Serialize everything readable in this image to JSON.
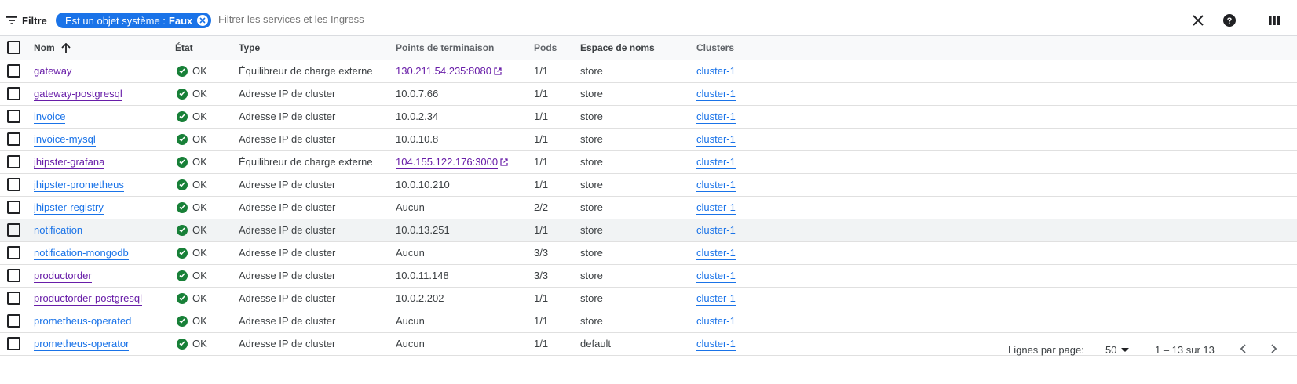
{
  "filter": {
    "label": "Filtre",
    "chip_key": "Est un objet système :",
    "chip_value": "Faux",
    "placeholder": "Filtrer les services et les Ingress"
  },
  "table": {
    "headers": {
      "name": "Nom",
      "status": "État",
      "type": "Type",
      "endpoints": "Points de terminaison",
      "pods": "Pods",
      "namespace": "Espace de noms",
      "clusters": "Clusters"
    },
    "rows": [
      {
        "name": "gateway",
        "status": "OK",
        "type": "Équilibreur de charge externe",
        "endpoint": "130.211.54.235:8080",
        "pods": "1/1",
        "namespace": "store",
        "cluster": "cluster-1"
      },
      {
        "name": "gateway-postgresql",
        "status": "OK",
        "type": "Adresse IP de cluster",
        "endpoint": "10.0.7.66",
        "pods": "1/1",
        "namespace": "store",
        "cluster": "cluster-1"
      },
      {
        "name": "invoice",
        "status": "OK",
        "type": "Adresse IP de cluster",
        "endpoint": "10.0.2.34",
        "pods": "1/1",
        "namespace": "store",
        "cluster": "cluster-1"
      },
      {
        "name": "invoice-mysql",
        "status": "OK",
        "type": "Adresse IP de cluster",
        "endpoint": "10.0.10.8",
        "pods": "1/1",
        "namespace": "store",
        "cluster": "cluster-1"
      },
      {
        "name": "jhipster-grafana",
        "status": "OK",
        "type": "Équilibreur de charge externe",
        "endpoint": "104.155.122.176:3000",
        "pods": "1/1",
        "namespace": "store",
        "cluster": "cluster-1"
      },
      {
        "name": "jhipster-prometheus",
        "status": "OK",
        "type": "Adresse IP de cluster",
        "endpoint": "10.0.10.210",
        "pods": "1/1",
        "namespace": "store",
        "cluster": "cluster-1"
      },
      {
        "name": "jhipster-registry",
        "status": "OK",
        "type": "Adresse IP de cluster",
        "endpoint": "Aucun",
        "pods": "2/2",
        "namespace": "store",
        "cluster": "cluster-1"
      },
      {
        "name": "notification",
        "status": "OK",
        "type": "Adresse IP de cluster",
        "endpoint": "10.0.13.251",
        "pods": "1/1",
        "namespace": "store",
        "cluster": "cluster-1"
      },
      {
        "name": "notification-mongodb",
        "status": "OK",
        "type": "Adresse IP de cluster",
        "endpoint": "Aucun",
        "pods": "3/3",
        "namespace": "store",
        "cluster": "cluster-1"
      },
      {
        "name": "productorder",
        "status": "OK",
        "type": "Adresse IP de cluster",
        "endpoint": "10.0.11.148",
        "pods": "3/3",
        "namespace": "store",
        "cluster": "cluster-1"
      },
      {
        "name": "productorder-postgresql",
        "status": "OK",
        "type": "Adresse IP de cluster",
        "endpoint": "10.0.2.202",
        "pods": "1/1",
        "namespace": "store",
        "cluster": "cluster-1"
      },
      {
        "name": "prometheus-operated",
        "status": "OK",
        "type": "Adresse IP de cluster",
        "endpoint": "Aucun",
        "pods": "1/1",
        "namespace": "store",
        "cluster": "cluster-1"
      },
      {
        "name": "prometheus-operator",
        "status": "OK",
        "type": "Adresse IP de cluster",
        "endpoint": "Aucun",
        "pods": "1/1",
        "namespace": "default",
        "cluster": "cluster-1"
      }
    ]
  },
  "pagination": {
    "rows_per_page_label": "Lignes par page:",
    "rows_per_page_value": "50",
    "range": "1 – 13 sur 13"
  },
  "colors": {
    "accent": "#1a73e8",
    "visited_link": "#681da8",
    "ok_green": "#188038"
  },
  "icons": {
    "filter": "filter-list-icon",
    "clear": "close-icon",
    "help": "help-icon",
    "columns": "column-display-icon",
    "status": "check-circle-icon",
    "external": "open-in-new-icon",
    "prev": "chevron-left-icon",
    "next": "chevron-right-icon"
  }
}
